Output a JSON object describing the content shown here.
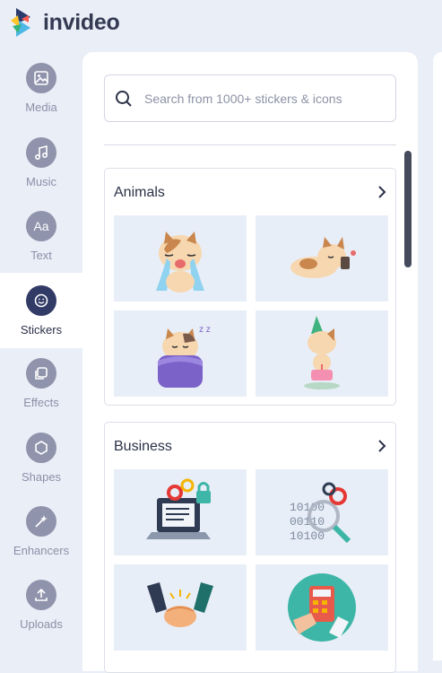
{
  "brand": {
    "name": "invideo"
  },
  "sidebar": {
    "items": [
      {
        "label": "Media",
        "icon": "image-icon"
      },
      {
        "label": "Music",
        "icon": "music-note-icon"
      },
      {
        "label": "Text",
        "icon": "text-aa-icon",
        "glyph": "Aa"
      },
      {
        "label": "Stickers",
        "icon": "smiley-icon",
        "active": true
      },
      {
        "label": "Effects",
        "icon": "layers-icon"
      },
      {
        "label": "Shapes",
        "icon": "hexagon-icon"
      },
      {
        "label": "Enhancers",
        "icon": "magic-wand-icon"
      },
      {
        "label": "Uploads",
        "icon": "upload-icon"
      }
    ]
  },
  "search": {
    "placeholder": "Search from 1000+ stickers & icons",
    "value": ""
  },
  "categories": [
    {
      "title": "Animals",
      "stickers": [
        "crying-cat-sticker",
        "sleeping-cat-sticker",
        "cat-in-bed-sticker",
        "birthday-cat-sticker"
      ]
    },
    {
      "title": "Business",
      "stickers": [
        "laptop-security-sticker",
        "binary-search-sticker",
        "handshake-sticker",
        "calculator-sticker"
      ]
    }
  ],
  "colors": {
    "accent": "#323a66",
    "tile_bg": "#e8eef7",
    "nav_inactive": "#8f93ab"
  }
}
